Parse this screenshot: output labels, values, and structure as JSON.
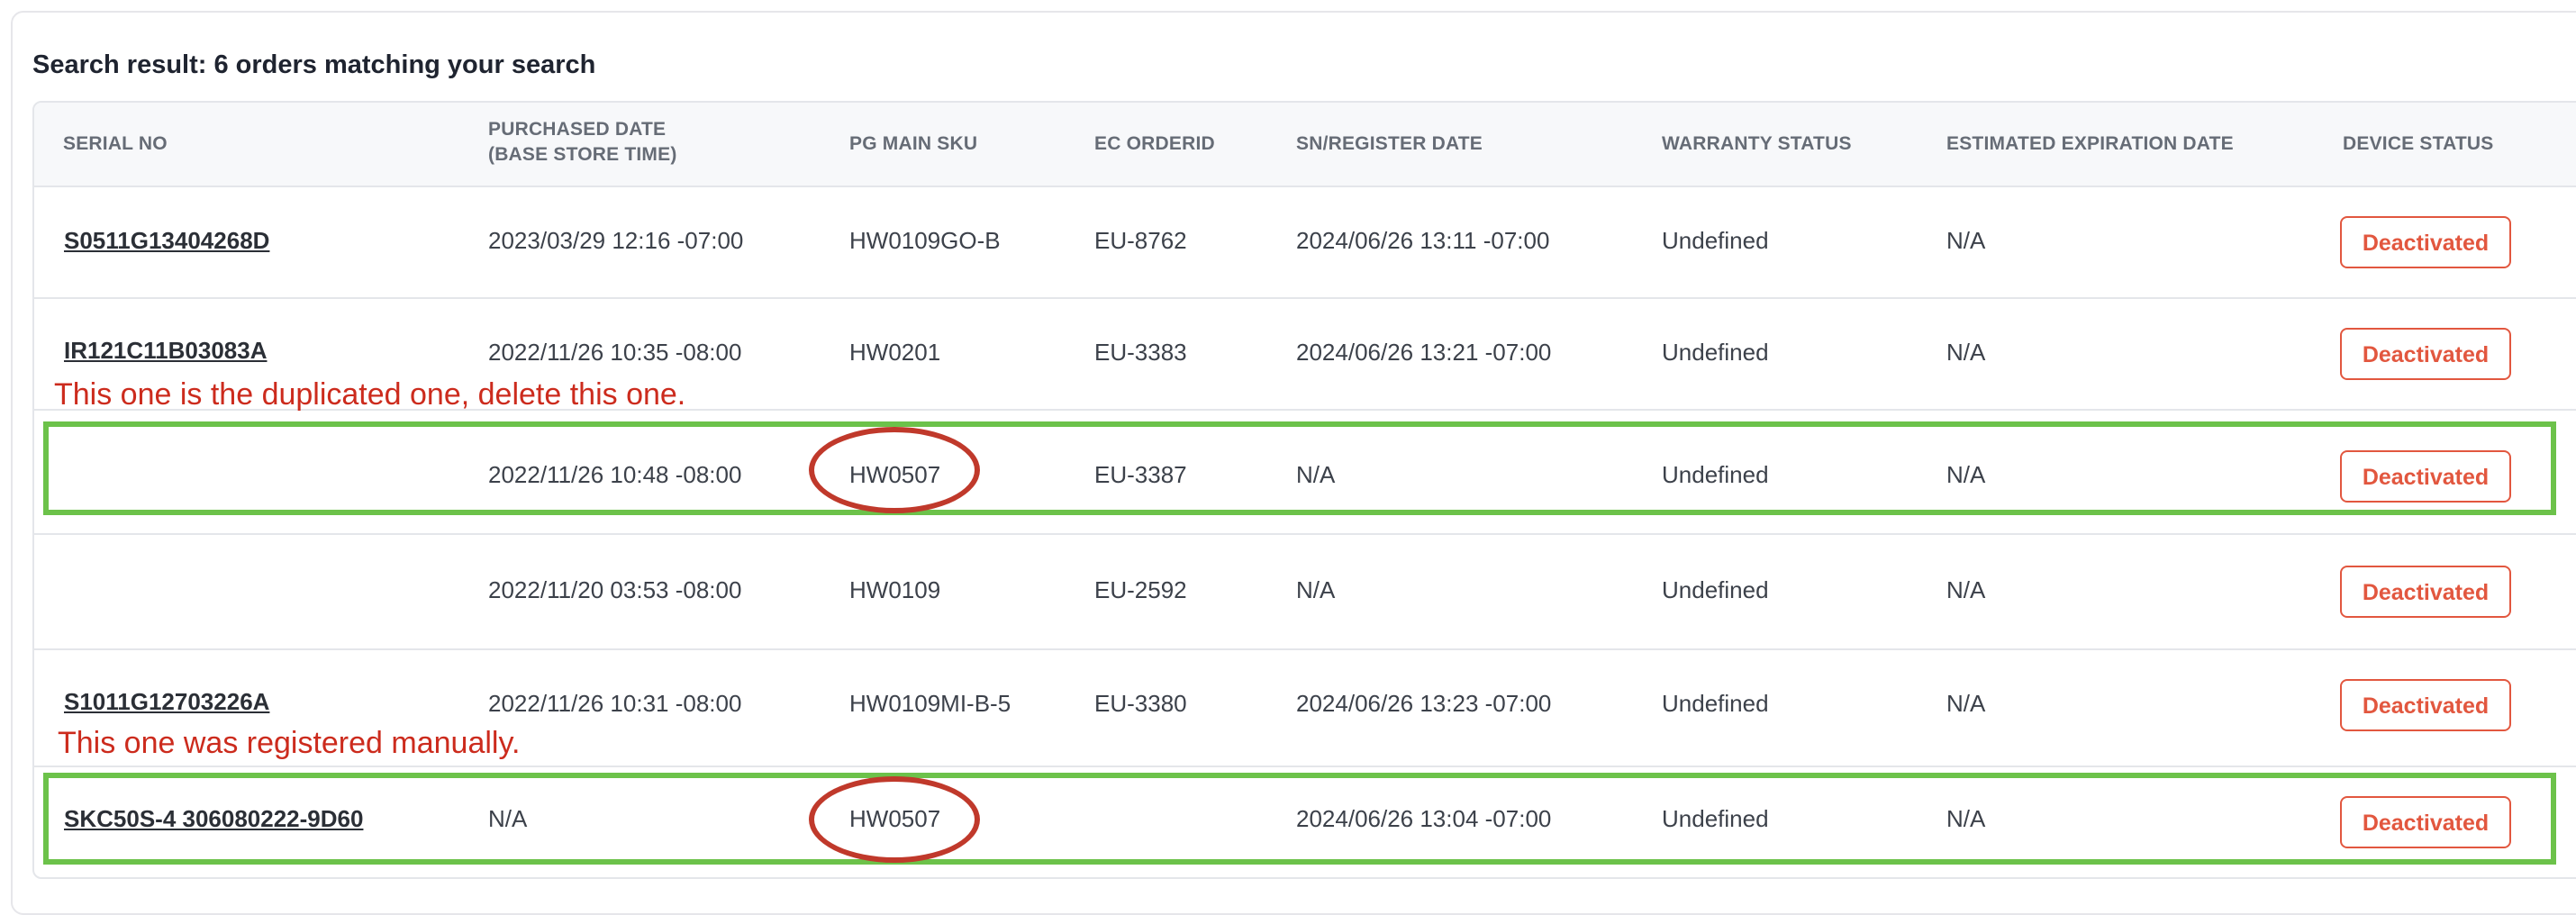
{
  "result_title": "Search result: 6 orders matching your search",
  "columns": {
    "serial_no": "SERIAL NO",
    "purchased_date": "PURCHASED DATE\n(BASE STORE TIME)",
    "main_sku": "PG MAIN SKU",
    "ec_order_id": "EC ORDERID",
    "register_date": "SN/REGISTER DATE",
    "warranty_status": "WARRANTY STATUS",
    "expiration_date": "ESTIMATED EXPIRATION DATE",
    "device_status": "DEVICE STATUS"
  },
  "rows": [
    {
      "serial": "S0511G13404268D",
      "purchased": "2023/03/29 12:16 -07:00",
      "sku": "HW0109GO-B",
      "order": "EU-8762",
      "register": "2024/06/26 13:11 -07:00",
      "warranty": "Undefined",
      "expiration": "N/A",
      "status": "Deactivated"
    },
    {
      "serial": "IR121C11B03083A",
      "purchased": "2022/11/26 10:35 -08:00",
      "sku": "HW0201",
      "order": "EU-3383",
      "register": "2024/06/26 13:21 -07:00",
      "warranty": "Undefined",
      "expiration": "N/A",
      "status": "Deactivated"
    },
    {
      "serial": "",
      "purchased": "2022/11/26 10:48 -08:00",
      "sku": "HW0507",
      "order": "EU-3387",
      "register": "N/A",
      "warranty": "Undefined",
      "expiration": "N/A",
      "status": "Deactivated"
    },
    {
      "serial": "",
      "purchased": "2022/11/20 03:53 -08:00",
      "sku": "HW0109",
      "order": "EU-2592",
      "register": "N/A",
      "warranty": "Undefined",
      "expiration": "N/A",
      "status": "Deactivated"
    },
    {
      "serial": "S1011G12703226A",
      "purchased": "2022/11/26 10:31 -08:00",
      "sku": "HW0109MI-B-5",
      "order": "EU-3380",
      "register": "2024/06/26 13:23 -07:00",
      "warranty": "Undefined",
      "expiration": "N/A",
      "status": "Deactivated"
    },
    {
      "serial": "SKC50S-4 306080222-9D60",
      "purchased": "N/A",
      "sku": "HW0507",
      "order": "",
      "register": "2024/06/26 13:04 -07:00",
      "warranty": "Undefined",
      "expiration": "N/A",
      "status": "Deactivated"
    }
  ],
  "annotations": {
    "duplicate_note": "This one is the duplicated one, delete this one.",
    "manual_note": "This one was registered manually."
  },
  "colors": {
    "status_accent": "#e2573f",
    "annotation_text": "#cc2b1d",
    "highlight_box": "#6cc24a",
    "circle_mark": "#c0392b"
  }
}
